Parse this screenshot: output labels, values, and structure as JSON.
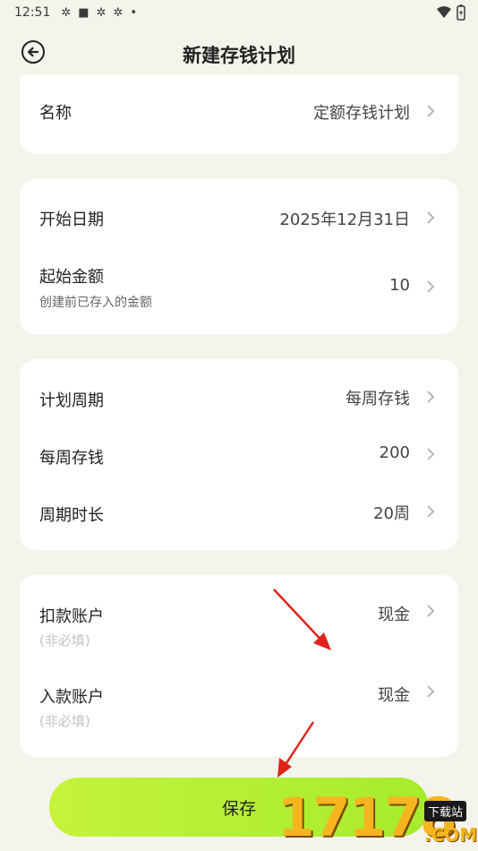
{
  "status_bar": {
    "time": "12:51",
    "icons": [
      "app-notification-icon",
      "app-notification-icon",
      "app-notification-icon",
      "app-notification-icon",
      "dot-icon"
    ],
    "wifi": "wifi-icon",
    "battery": "battery-charging-icon"
  },
  "header": {
    "title": "新建存钱计划",
    "back_icon": "back-circle-icon"
  },
  "name_card": {
    "label": "名称",
    "value": "定额存钱计划"
  },
  "date_card": {
    "start_date": {
      "label": "开始日期",
      "value": "2025年12月31日"
    },
    "start_amount": {
      "label": "起始金额",
      "sub": "创建前已存入的金额",
      "value": "10"
    }
  },
  "cycle_card": {
    "plan_cycle": {
      "label": "计划周期",
      "value": "每周存钱"
    },
    "weekly_saving": {
      "label": "每周存钱",
      "value": "200"
    },
    "duration": {
      "label": "周期时长",
      "value": "20周"
    }
  },
  "account_card": {
    "debit": {
      "label": "扣款账户",
      "hint": "(非必填)",
      "value": "现金"
    },
    "credit": {
      "label": "入款账户",
      "hint": "(非必填)",
      "value": "现金"
    }
  },
  "save_button": {
    "label": "保存"
  },
  "watermark": {
    "digits": "17178",
    "badge": "下载站",
    "domain": ".COM"
  },
  "colors": {
    "background": "#f4f4ec",
    "card": "#ffffff",
    "button": "#b8f035",
    "annotation_arrow": "#e0241b",
    "watermark": "#f6b51e"
  }
}
